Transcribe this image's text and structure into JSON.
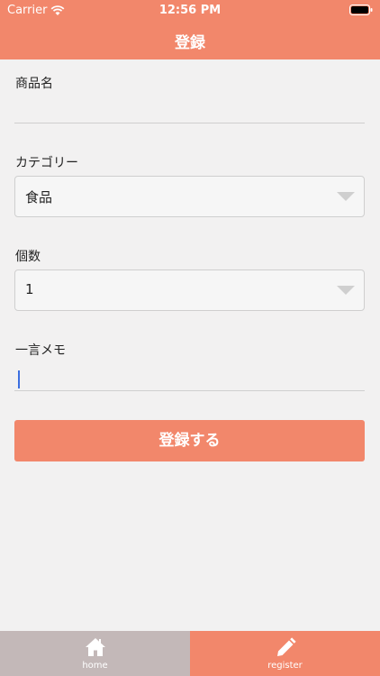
{
  "status": {
    "carrier": "Carrier",
    "time": "12:56 PM"
  },
  "header": {
    "title": "登録"
  },
  "form": {
    "product_name_label": "商品名",
    "product_name_value": "",
    "category_label": "カテゴリー",
    "category_value": "食品",
    "quantity_label": "個数",
    "quantity_value": "1",
    "memo_label": "一言メモ",
    "memo_value": "",
    "submit_label": "登録する"
  },
  "tabbar": {
    "home_label": "home",
    "register_label": "register"
  },
  "colors": {
    "accent": "#f2876b",
    "inactive_tab": "#c3b8b8",
    "background": "#f2f1f1"
  }
}
